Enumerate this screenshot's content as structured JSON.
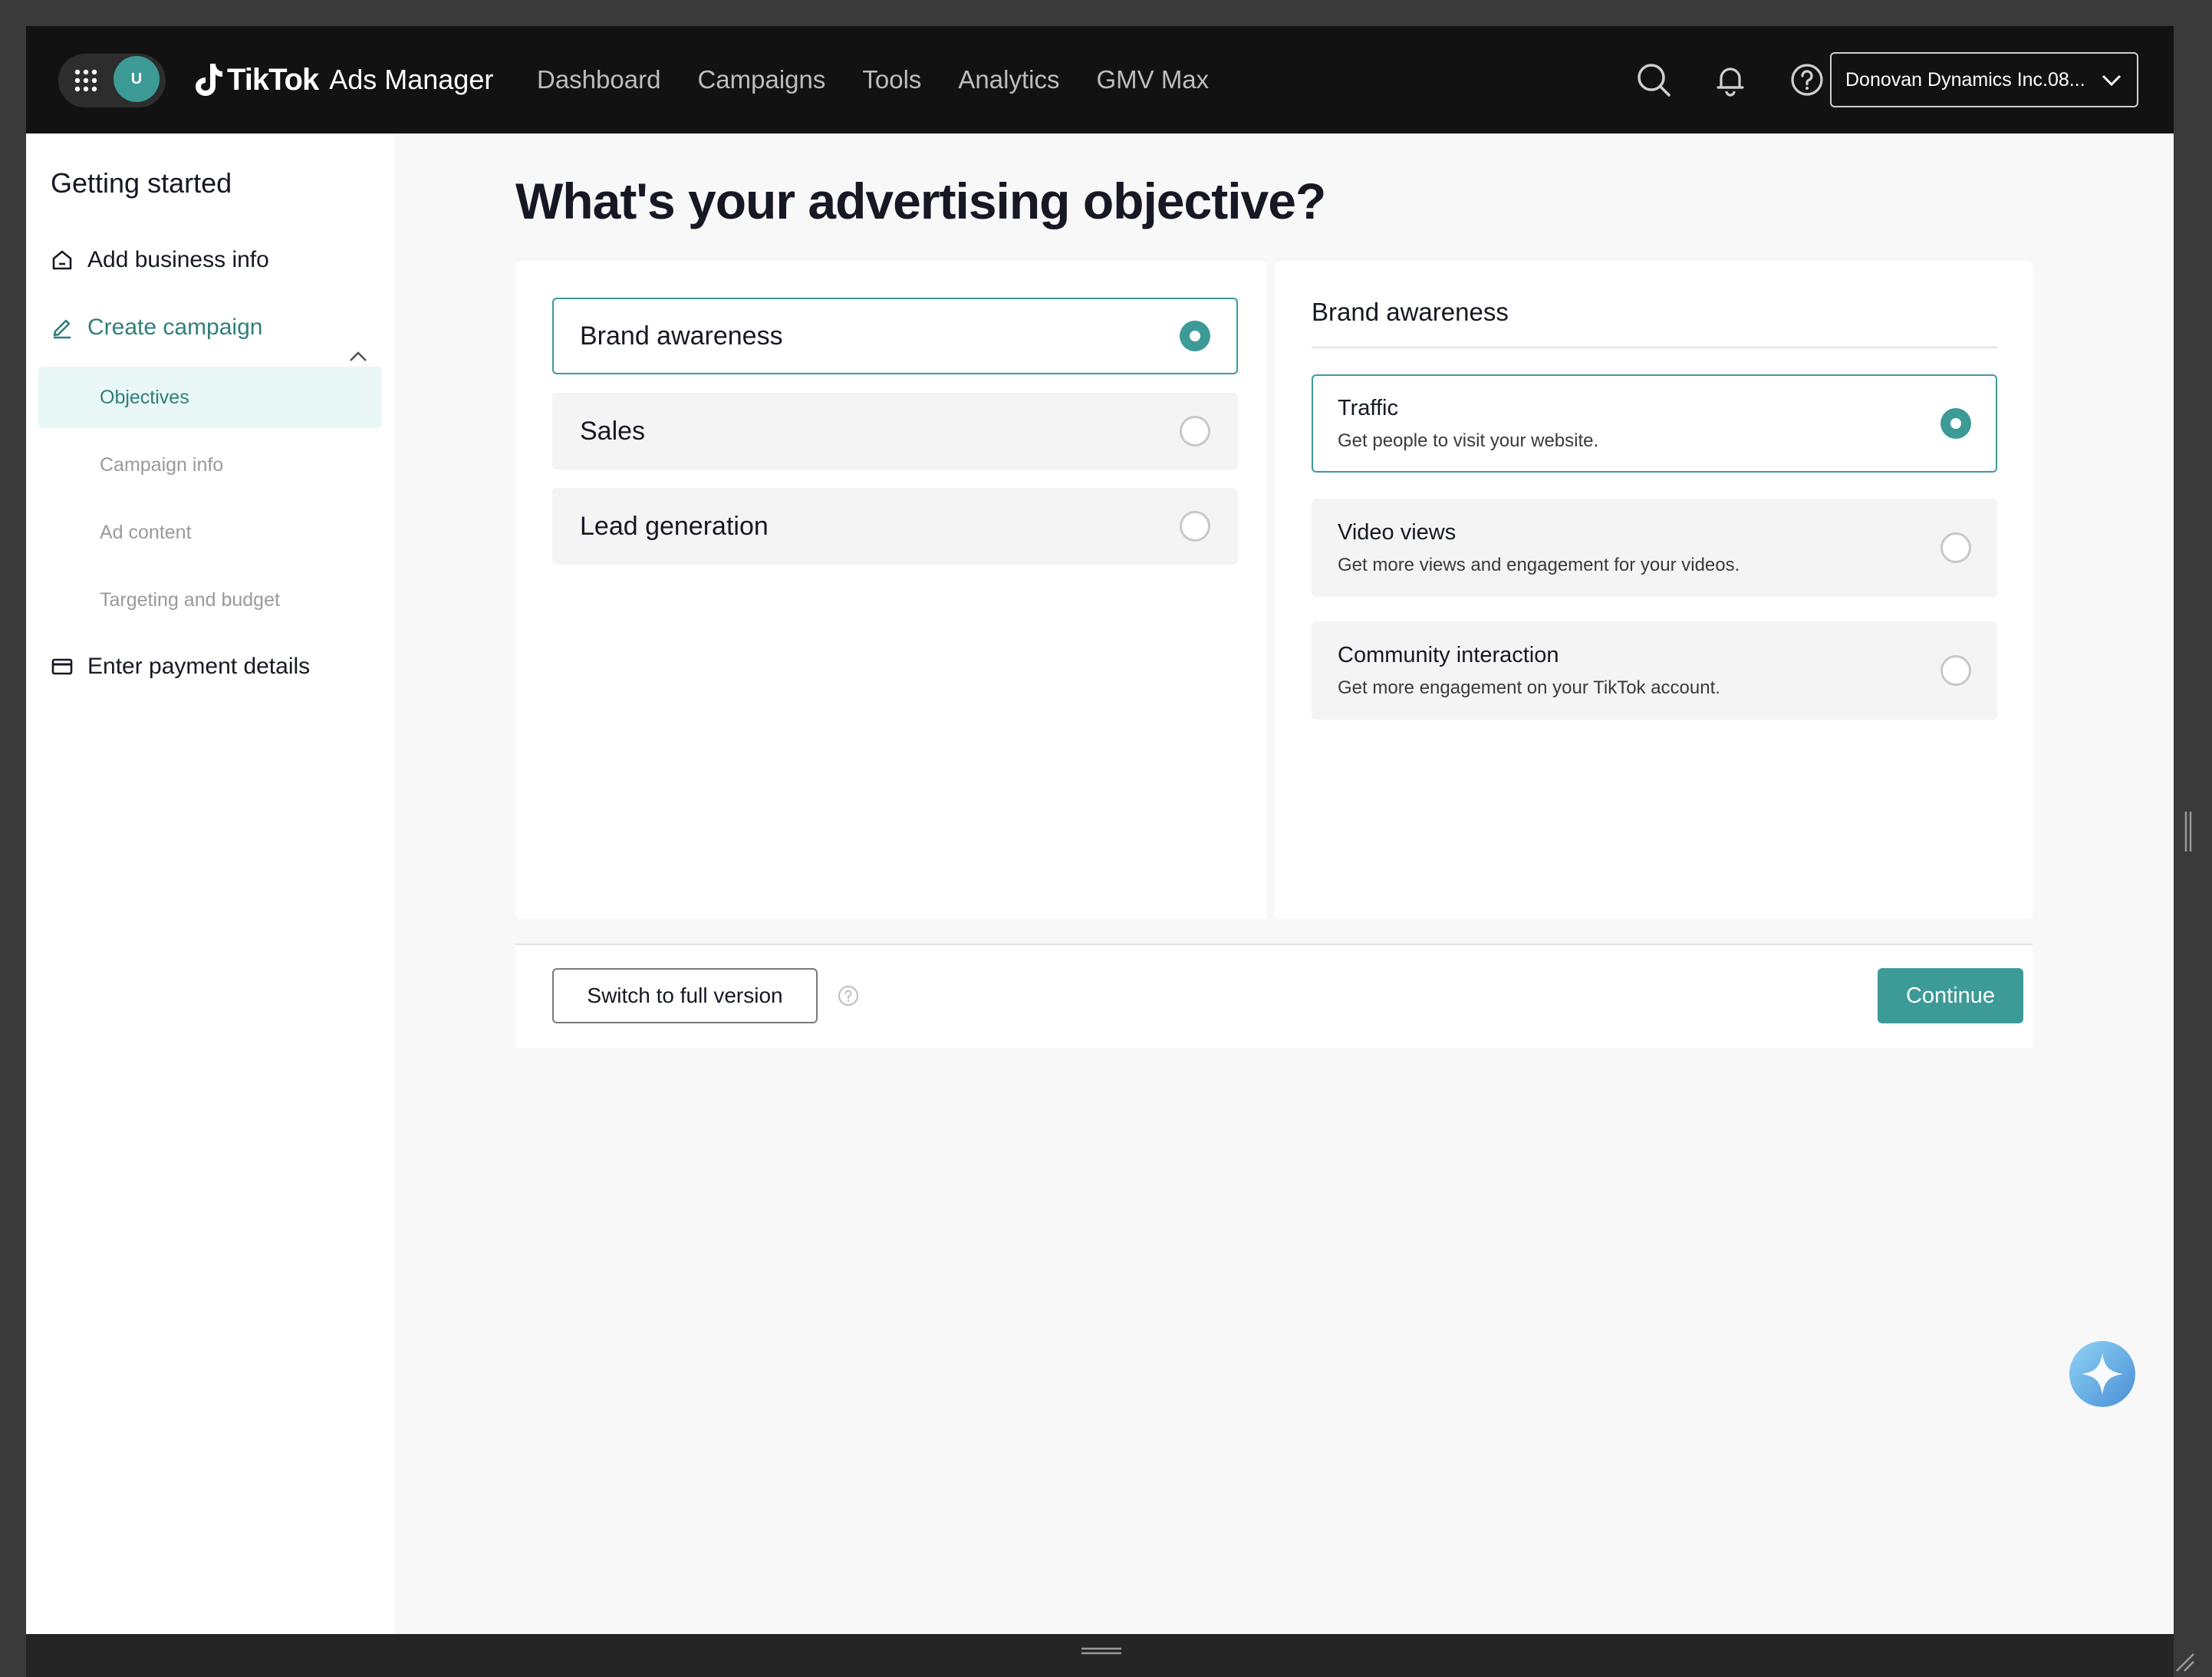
{
  "header": {
    "avatar_initial": "U",
    "brand": "TikTok",
    "brand_sub": "Ads Manager",
    "nav": [
      "Dashboard",
      "Campaigns",
      "Tools",
      "Analytics",
      "GMV Max"
    ],
    "account": "Donovan Dynamics Inc.08..."
  },
  "sidebar": {
    "title": "Getting started",
    "add_business": "Add business info",
    "create_campaign": "Create campaign",
    "sub_items": [
      "Objectives",
      "Campaign info",
      "Ad content",
      "Targeting and budget"
    ],
    "payment": "Enter payment details"
  },
  "main": {
    "headline": "What's your advertising objective?",
    "objectives": [
      {
        "label": "Brand awareness",
        "selected": true
      },
      {
        "label": "Sales",
        "selected": false
      },
      {
        "label": "Lead generation",
        "selected": false
      }
    ],
    "detail_title": "Brand awareness",
    "goals": [
      {
        "title": "Traffic",
        "desc": "Get people to visit your website.",
        "selected": true
      },
      {
        "title": "Video views",
        "desc": "Get more views and engagement for your videos.",
        "selected": false
      },
      {
        "title": "Community interaction",
        "desc": "Get more engagement on your TikTok account.",
        "selected": false
      }
    ]
  },
  "footer": {
    "switch_label": "Switch to full version",
    "continue_label": "Continue"
  },
  "colors": {
    "accent": "#3c9b96",
    "topbar": "#121212",
    "selected_bg": "#e9f7f6"
  }
}
